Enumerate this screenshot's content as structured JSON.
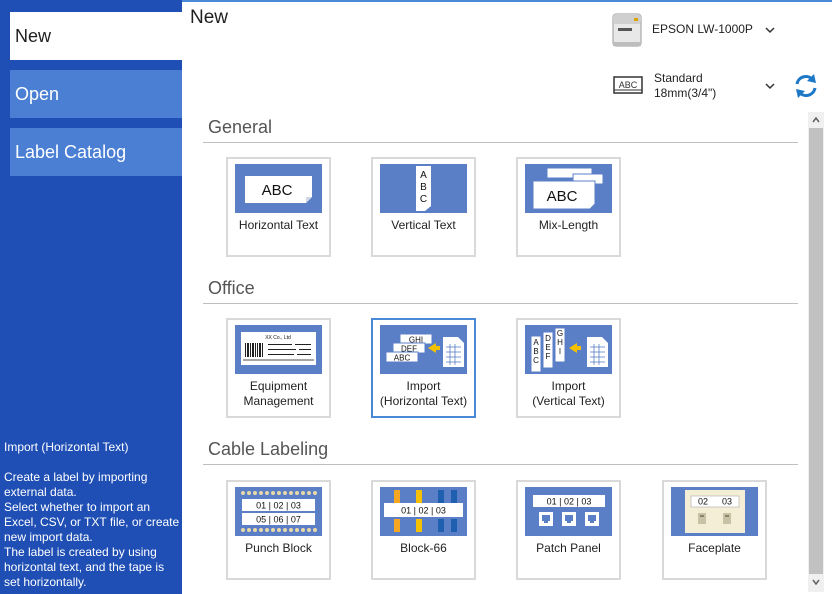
{
  "sidebar": {
    "items": [
      {
        "label": "New"
      },
      {
        "label": "Open"
      },
      {
        "label": "Label Catalog"
      }
    ],
    "description": {
      "title": "Import (Horizontal Text)",
      "body": "Create a label by importing external data.\nSelect whether to import an Excel, CSV, or TXT file, or create new import data.\nThe label is created by using horizontal text, and the tape is set horizontally."
    }
  },
  "header": {
    "title": "New",
    "printer": "EPSON LW-1000P",
    "tape_line1": "Standard",
    "tape_line2": "18mm(3/4\")",
    "tape_icon_text": "ABC"
  },
  "sections": [
    {
      "title": "General",
      "tiles": [
        {
          "line1": "Horizontal Text",
          "line2": ""
        },
        {
          "line1": "Vertical Text",
          "line2": ""
        },
        {
          "line1": "Mix-Length",
          "line2": ""
        }
      ]
    },
    {
      "title": "Office",
      "tiles": [
        {
          "line1": "Equipment",
          "line2": "Management"
        },
        {
          "line1": "Import",
          "line2": "(Horizontal Text)"
        },
        {
          "line1": "Import",
          "line2": "(Vertical Text)"
        }
      ]
    },
    {
      "title": "Cable Labeling",
      "tiles": [
        {
          "line1": "Punch Block",
          "line2": ""
        },
        {
          "line1": "Block-66",
          "line2": ""
        },
        {
          "line1": "Patch Panel",
          "line2": ""
        },
        {
          "line1": "Faceplate",
          "line2": ""
        }
      ]
    }
  ],
  "thumb_text": {
    "abc": "ABC",
    "v_a": "A",
    "v_b": "B",
    "v_c": "C",
    "ghi": "GHI",
    "def": "DEF",
    "g": "G",
    "h": "H",
    "i": "I",
    "d": "D",
    "e": "E",
    "f": "F",
    "equip_title": "XX Co., Ltd",
    "punch_r1": "01 | 02 | 03",
    "punch_r2": "05 | 06 | 07",
    "block_row": "01 | 02 | 03",
    "patch_row": "01 | 02 | 03",
    "face_a": "02",
    "face_b": "03"
  },
  "colors": {
    "sidebar": "#1f4fb5",
    "nav_item": "#4a7fd4",
    "thumb_bg": "#5b7fc7",
    "selected_border": "#4a88d8",
    "refresh": "#1e78c8"
  },
  "state": {
    "active_nav": "New",
    "selected_tile": "Import (Horizontal Text)"
  }
}
